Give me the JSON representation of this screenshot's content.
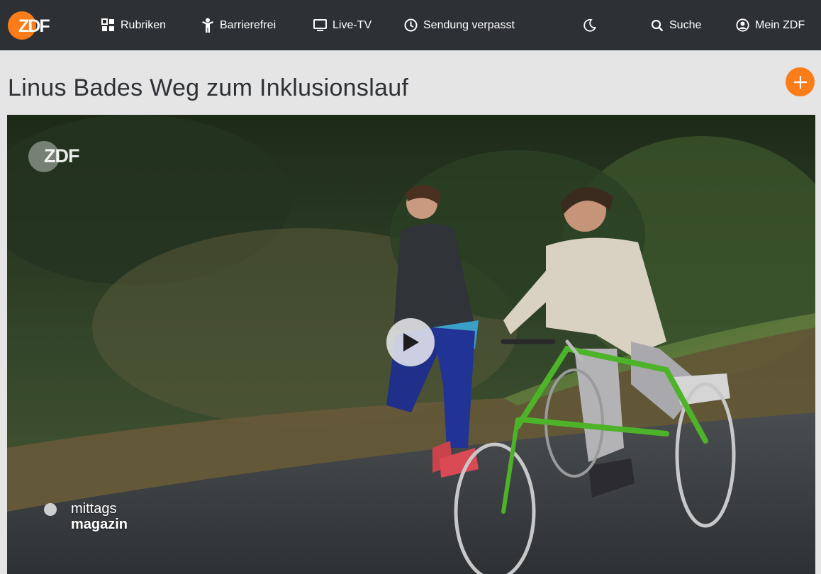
{
  "header": {
    "logo_text": "ZDF",
    "nav": {
      "rubriken": "Rubriken",
      "barrierefrei": "Barrierefrei",
      "livetv": "Live-TV",
      "verpasst": "Sendung verpasst",
      "suche": "Suche",
      "meinzdf": "Mein ZDF"
    },
    "icons": {
      "rubriken": "grid-icon",
      "barrierefrei": "accessibility-icon",
      "livetv": "tv-icon",
      "verpasst": "clock-icon",
      "darkmode": "moon-icon",
      "suche": "search-icon",
      "meinzdf": "user-icon"
    }
  },
  "page": {
    "title": "Linus Bades Weg zum Inklusionslauf"
  },
  "video": {
    "watermark": "ZDF",
    "show_logo_line1": "mittags",
    "show_logo_line2": "magazin"
  },
  "colors": {
    "header_bg": "#2d3034",
    "accent": "#fa7d19",
    "page_bg": "#e5e5e5"
  }
}
